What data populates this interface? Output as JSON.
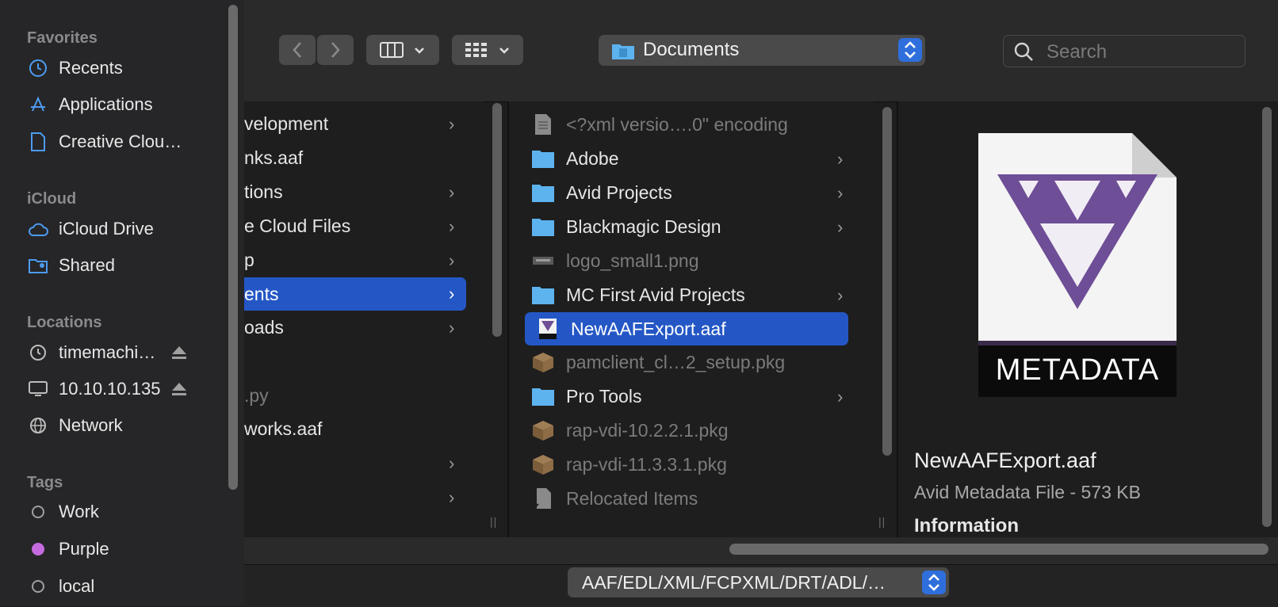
{
  "sidebar": {
    "favorites_header": "Favorites",
    "favorites": [
      {
        "label": "Recents",
        "icon": "clock-icon"
      },
      {
        "label": "Applications",
        "icon": "applications-icon"
      },
      {
        "label": "Creative Clou…",
        "icon": "document-icon"
      }
    ],
    "icloud_header": "iCloud",
    "icloud": [
      {
        "label": "iCloud Drive",
        "icon": "cloud-icon"
      },
      {
        "label": "Shared",
        "icon": "shared-folder-icon"
      }
    ],
    "locations_header": "Locations",
    "locations": [
      {
        "label": "timemachi…",
        "icon": "time-machine-icon"
      },
      {
        "label": "10.10.10.135",
        "icon": "monitor-icon"
      },
      {
        "label": "Network",
        "icon": "globe-icon"
      }
    ],
    "tags_header": "Tags",
    "tags": [
      {
        "label": "Work",
        "color": "#00000000"
      },
      {
        "label": "Purple",
        "color": "#c56be0"
      },
      {
        "label": "local",
        "color": "#00000000"
      }
    ]
  },
  "toolbar": {
    "path_label": "Documents",
    "search_placeholder": "Search"
  },
  "column1": [
    {
      "label": "velopment",
      "chevron": true
    },
    {
      "label": "nks.aaf",
      "chevron": false
    },
    {
      "label": "tions",
      "chevron": true
    },
    {
      "label": "e Cloud Files",
      "chevron": true
    },
    {
      "label": "p",
      "chevron": true
    },
    {
      "label": "ents",
      "chevron": true,
      "selected": true
    },
    {
      "label": "oads",
      "chevron": true
    },
    {
      "label": "",
      "chevron": false
    },
    {
      "label": ".py",
      "chevron": false,
      "dim": true
    },
    {
      "label": "works.aaf",
      "chevron": false
    },
    {
      "label": "",
      "chevron": true
    },
    {
      "label": "",
      "chevron": true
    }
  ],
  "column2": [
    {
      "label": "<?xml versio….0\" encoding",
      "type": "text",
      "dim": true
    },
    {
      "label": "Adobe",
      "type": "folder",
      "chevron": true
    },
    {
      "label": "Avid Projects",
      "type": "folder",
      "chevron": true
    },
    {
      "label": "Blackmagic Design",
      "type": "folder",
      "chevron": true
    },
    {
      "label": "logo_small1.png",
      "type": "image",
      "dim": true
    },
    {
      "label": "MC First Avid Projects",
      "type": "folder",
      "chevron": true
    },
    {
      "label": "NewAAFExport.aaf",
      "type": "meta",
      "selected": true
    },
    {
      "label": "pamclient_cl…2_setup.pkg",
      "type": "pkg",
      "dim": true
    },
    {
      "label": "Pro Tools",
      "type": "folder",
      "chevron": true
    },
    {
      "label": "rap-vdi-10.2.2.1.pkg",
      "type": "pkg",
      "dim": true
    },
    {
      "label": "rap-vdi-11.3.3.1.pkg",
      "type": "pkg",
      "dim": true
    },
    {
      "label": "Relocated Items",
      "type": "alias",
      "dim": true
    }
  ],
  "preview": {
    "icon_text": "METADATA",
    "filename": "NewAAFExport.aaf",
    "kind": "Avid Metadata File - 573 KB",
    "section": "Information"
  },
  "bottom": {
    "filter_label": "AAF/EDL/XML/FCPXML/DRT/ADL/…"
  },
  "colors": {
    "selection": "#2457c5",
    "folder": "#5db3ee",
    "accent": "#2f6fdc",
    "metadata_purple": "#6e4e96"
  }
}
